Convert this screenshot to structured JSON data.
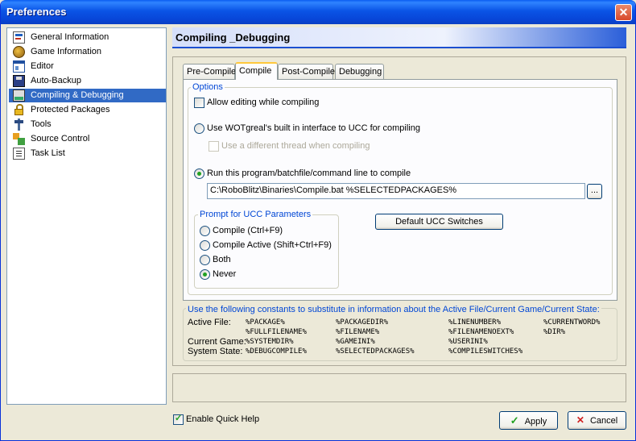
{
  "window": {
    "title": "Preferences"
  },
  "nav": {
    "items": [
      {
        "label": "General Information",
        "icon": "info-icon"
      },
      {
        "label": "Game Information",
        "icon": "game-icon"
      },
      {
        "label": "Editor",
        "icon": "editor-icon"
      },
      {
        "label": "Auto-Backup",
        "icon": "floppy-icon"
      },
      {
        "label": "Compiling & Debugging",
        "icon": "compile-icon",
        "selected": true
      },
      {
        "label": "Protected Packages",
        "icon": "lock-icon"
      },
      {
        "label": "Tools",
        "icon": "tools-icon"
      },
      {
        "label": "Source Control",
        "icon": "source-control-icon"
      },
      {
        "label": "Task List",
        "icon": "task-list-icon"
      }
    ]
  },
  "header": {
    "title": "Compiling _Debugging"
  },
  "tabs": [
    {
      "label": "Pre-Compile"
    },
    {
      "label": "Compile",
      "active": true
    },
    {
      "label": "Post-Compile"
    },
    {
      "label": "Debugging"
    }
  ],
  "options": {
    "group_label": "Options",
    "allow_editing": {
      "label": "Allow editing while compiling",
      "checked": false
    },
    "builtin_interface": {
      "label": "Use WOTgreal's built in interface to UCC for compiling",
      "selected": false
    },
    "different_thread": {
      "label": "Use a different thread when compiling",
      "checked": false,
      "enabled": false
    },
    "run_program": {
      "label": "Run this program/batchfile/command line to compile",
      "selected": true
    },
    "command_value": "C:\\RoboBlitz\\Binaries\\Compile.bat %SELECTEDPACKAGES%",
    "browse_label": "..."
  },
  "prompt": {
    "group_label": "Prompt for UCC Parameters",
    "choices": [
      {
        "label": "Compile (Ctrl+F9)",
        "selected": false
      },
      {
        "label": "Compile Active (Shift+Ctrl+F9)",
        "selected": false
      },
      {
        "label": "Both",
        "selected": false
      },
      {
        "label": "Never",
        "selected": true
      }
    ]
  },
  "default_switches_label": "Default UCC Switches",
  "constants": {
    "heading": "Use the following constants to substitute in information about the Active File/Current Game/Current State:",
    "rows": [
      {
        "label": "Active File:",
        "values": [
          "%PACKAGE%",
          "%PACKAGEDIR%",
          "%LINENUMBER%",
          "%CURRENTWORD%"
        ]
      },
      {
        "label": "",
        "values": [
          "%FULLFILENAME%",
          "%FILENAME%",
          "%FILENAMENOEXT%",
          "%DIR%"
        ]
      },
      {
        "label": "Current Game:",
        "values": [
          "%SYSTEMDIR%",
          "%GAMEINI%",
          "%USERINI%",
          ""
        ]
      },
      {
        "label": "System State:",
        "values": [
          "%DEBUGCOMPILE%",
          "%SELECTEDPACKAGES%",
          "%COMPILESWITCHES%",
          ""
        ]
      }
    ]
  },
  "quick_help": {
    "label": "Enable Quick Help",
    "checked": true
  },
  "buttons": {
    "apply": "Apply",
    "cancel": "Cancel"
  },
  "colors": {
    "selection": "#316ac5",
    "title_bar": "#0a54e6",
    "group_label": "#0046d5",
    "radio_dot": "#21a121"
  }
}
